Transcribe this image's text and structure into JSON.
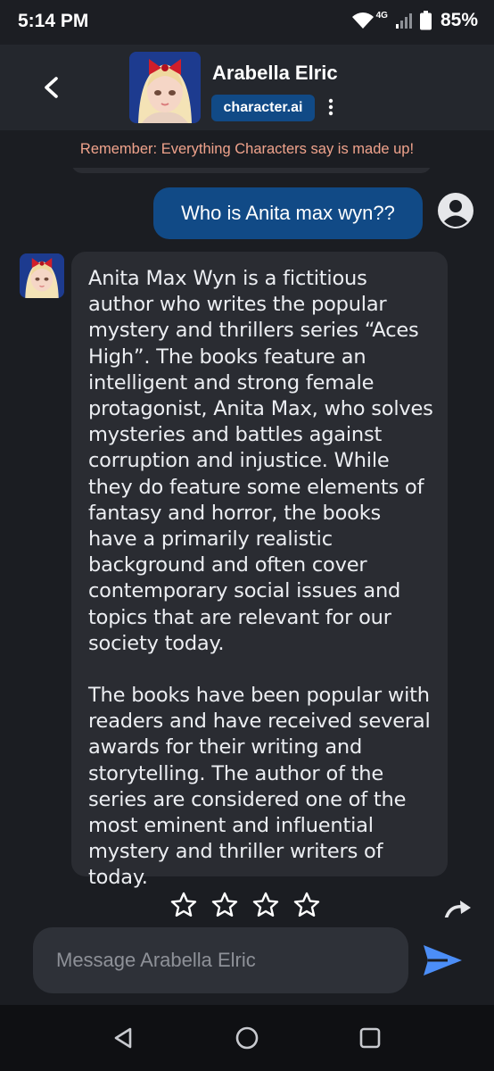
{
  "status_bar": {
    "time": "5:14 PM",
    "network_label": "4G",
    "battery": "85%"
  },
  "header": {
    "character_name": "Arabella Elric",
    "brand": "character.ai"
  },
  "disclaimer": "Remember: Everything Characters say is made up!",
  "messages": [
    {
      "sender": "user",
      "text": "Who is Anita max wyn??"
    },
    {
      "sender": "character",
      "paragraphs": [
        "Anita Max Wyn is a fictitious author who writes the popular mystery and thrillers series “Aces High”. The books feature an intelligent and strong female protagonist, Anita Max, who solves mysteries and battles against corruption and injustice. While they do feature some elements of fantasy and horror, the books have a primarily realistic background and often cover contemporary social issues and topics that are relevant for our society today.",
        "The books have been popular with readers and have received several awards for their writing and storytelling. The author of the series are considered one of the most eminent and influential mystery and thriller writers of today."
      ],
      "rating": {
        "stars_total": 4,
        "stars_selected": 0
      }
    }
  ],
  "composer": {
    "placeholder": "Message Arabella Elric",
    "value": ""
  },
  "icons": {
    "back": "chevron-left-icon",
    "more": "kebab-menu-icon",
    "user_avatar": "account-circle-icon",
    "star": "star-outline-icon",
    "regenerate": "redo-arrow-icon",
    "send": "send-arrow-icon",
    "nav": [
      "nav-back-icon",
      "nav-home-icon",
      "nav-recents-icon"
    ]
  },
  "colors": {
    "background": "#1b1d22",
    "header": "#24272d",
    "accent": "#114a86",
    "send": "#4c8ef7",
    "disclaimer": "#f0a38c",
    "bubble": "#2a2c32"
  }
}
